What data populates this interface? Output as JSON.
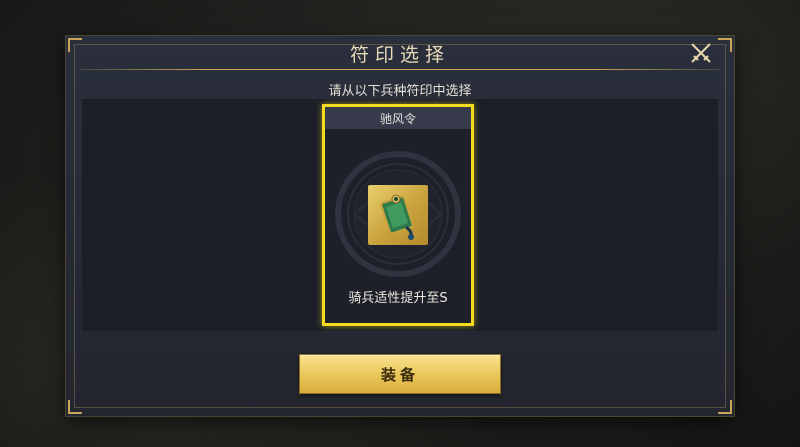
{
  "dialog": {
    "title": "符印选择",
    "instruction": "请从以下兵种符印中选择",
    "close_icon": "crossed-swords-icon"
  },
  "card": {
    "name": "驰风令",
    "description": "骑兵适性提升至S",
    "icon": "jade-token-seal-icon",
    "selected": true
  },
  "actions": {
    "equip_label": "装备"
  },
  "colors": {
    "accent_gold": "#c9a55a",
    "selection_yellow": "#f4dc1c",
    "button_gold": "#ecc85c",
    "panel_bg": "#1c1f28"
  }
}
